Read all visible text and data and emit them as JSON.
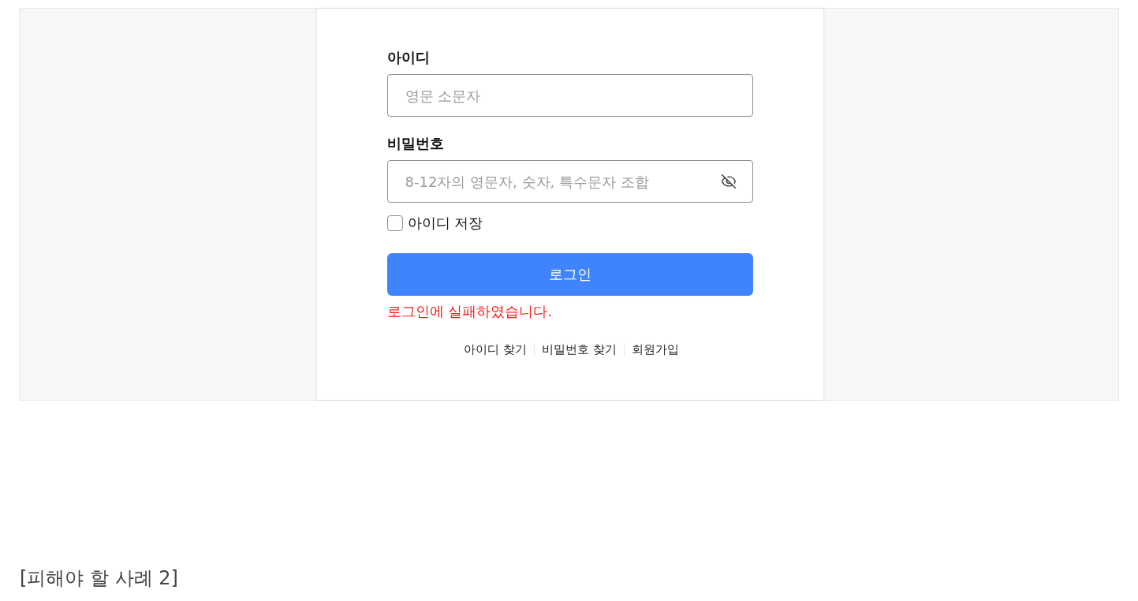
{
  "login_form": {
    "fields": [
      {
        "kind": "text",
        "label": "아이디",
        "placeholder": "영문 소문자"
      },
      {
        "kind": "password",
        "label": "비밀번호",
        "placeholder": "8-12자의 영문자, 숫자, 특수문자 조합"
      }
    ],
    "remember_id": {
      "label": "아이디 저장",
      "checked": false
    },
    "login_button": "로그인",
    "error_message": "로그인에 실패하였습니다.",
    "links": [
      "아이디 찾기",
      "비밀번호 찾기",
      "회원가입"
    ]
  },
  "caption": "[피해야 할 사례 2]"
}
